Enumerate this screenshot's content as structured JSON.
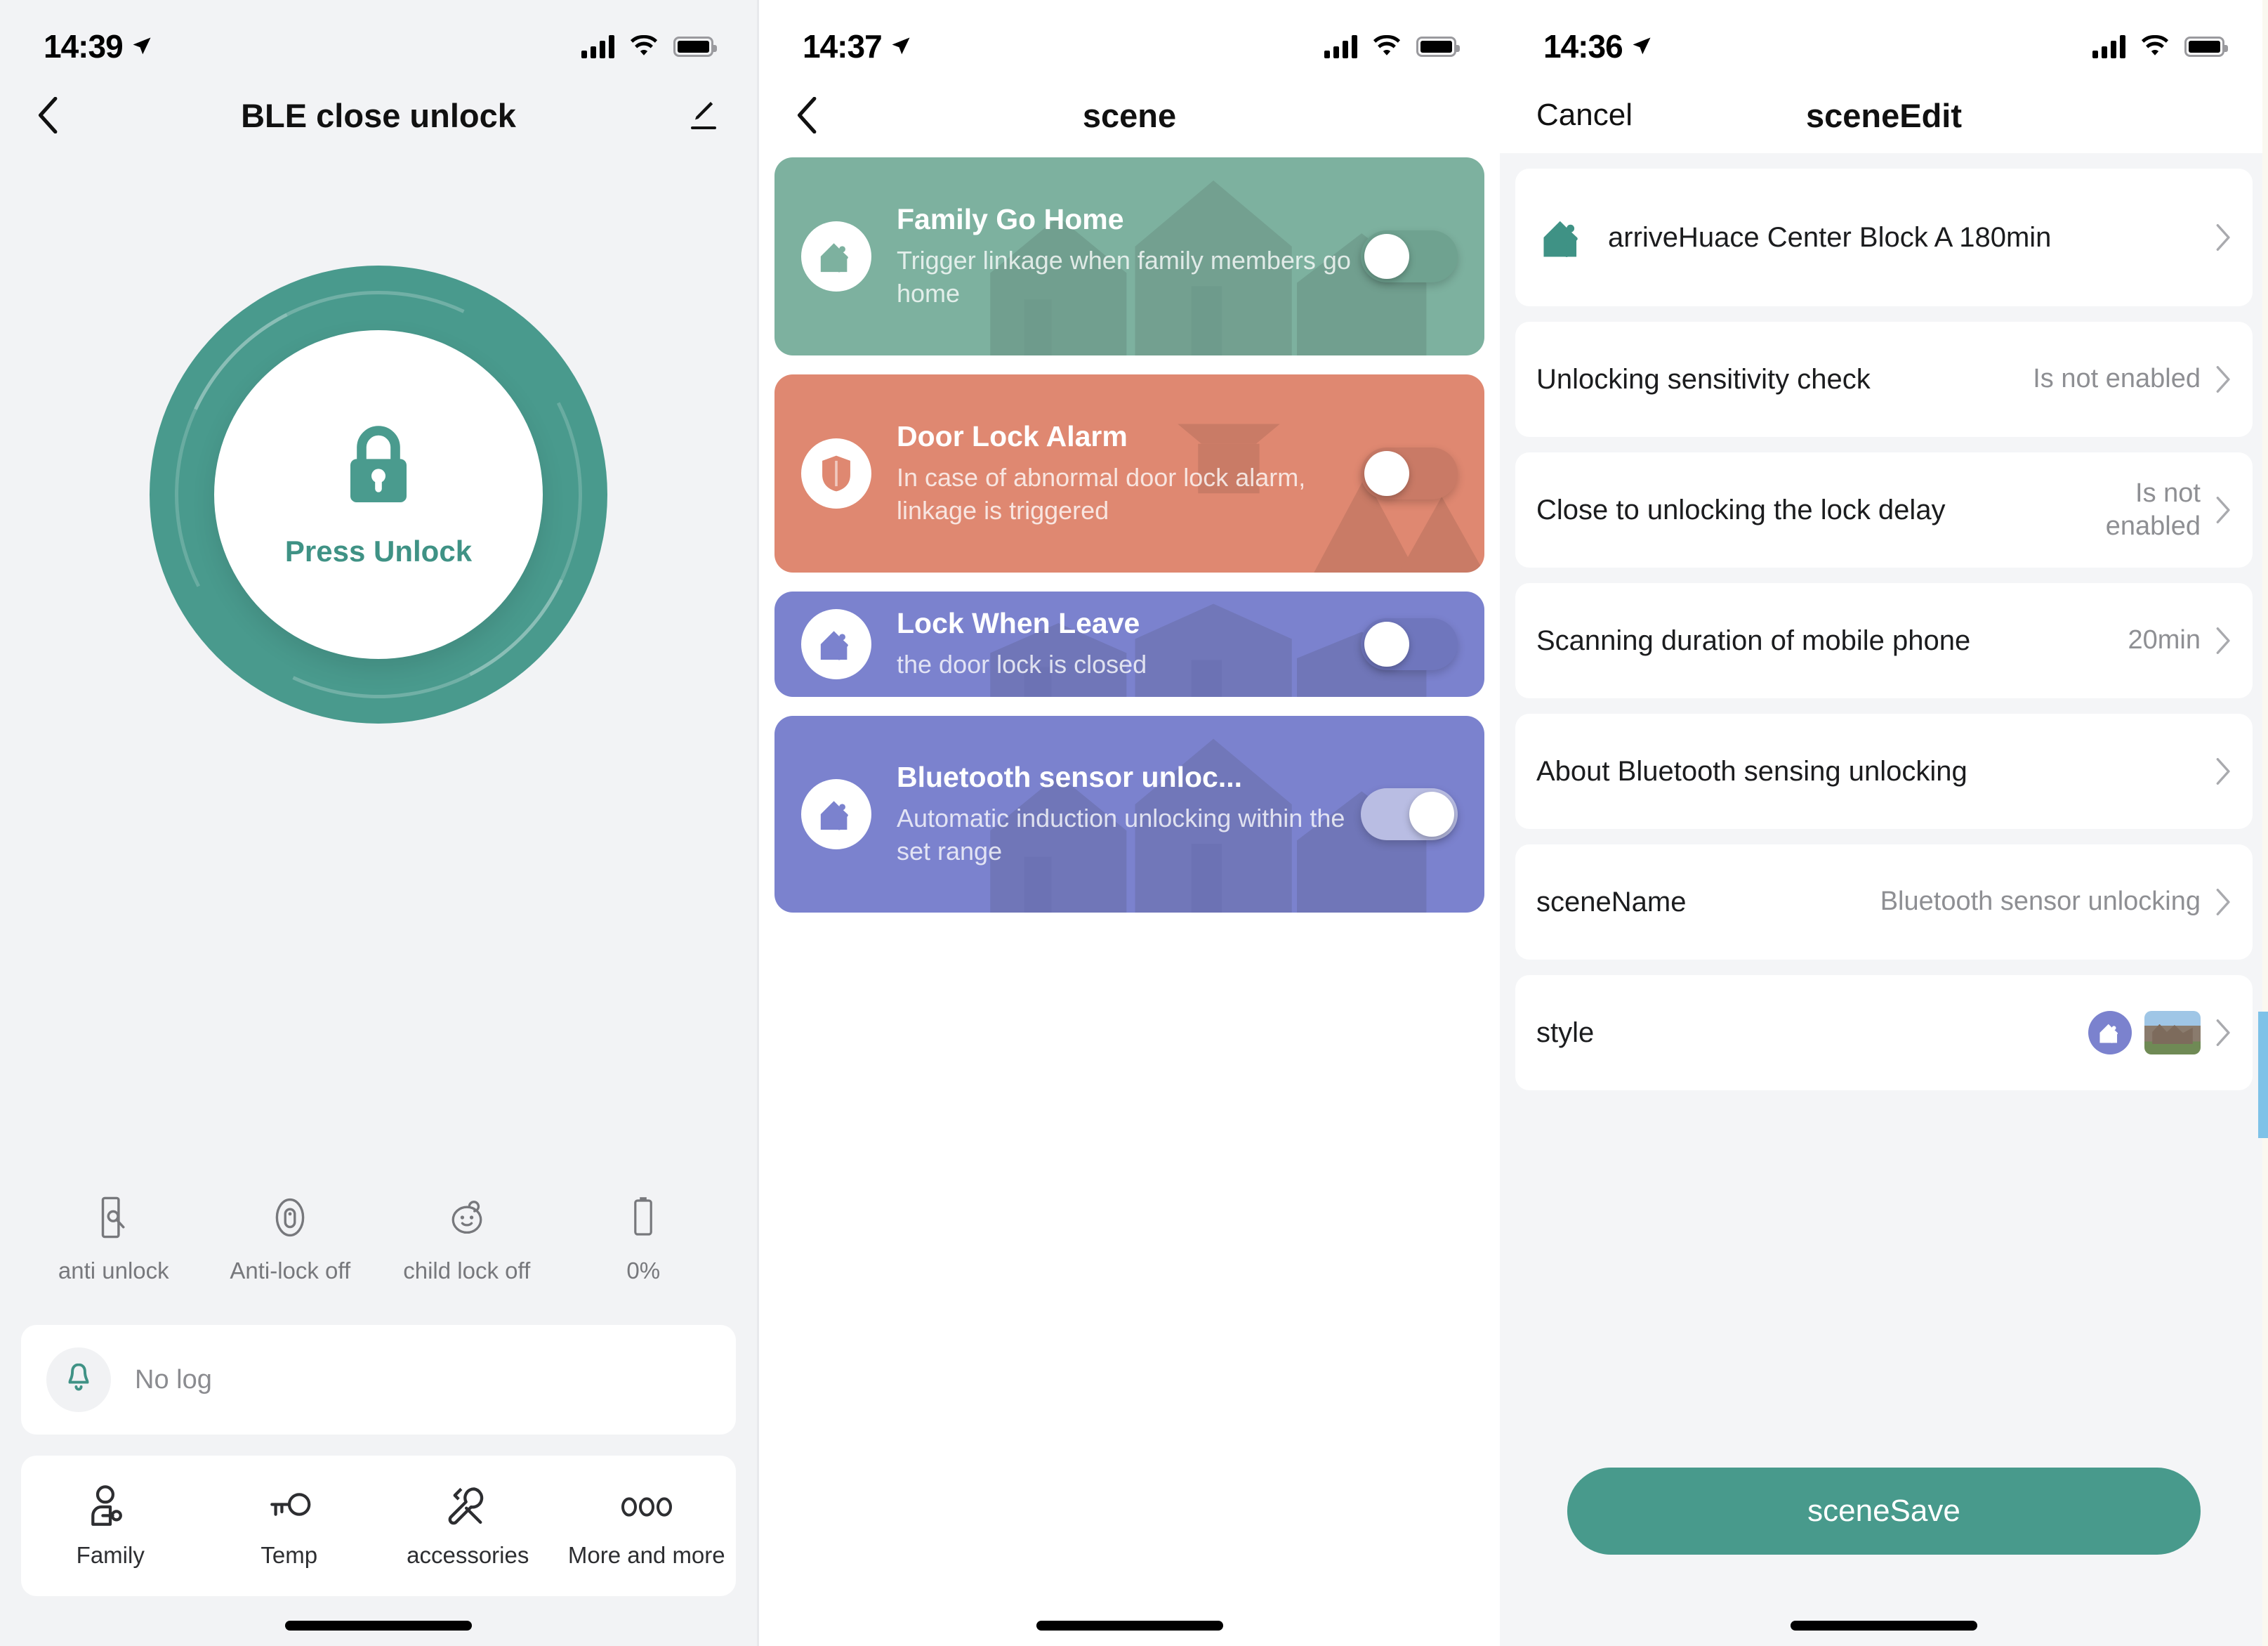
{
  "panel1": {
    "status": {
      "time": "14:39",
      "location_icon": "location-arrow-icon",
      "signal": "cellular-signal-icon",
      "wifi": "wifi-icon",
      "battery": "battery-icon"
    },
    "nav": {
      "back_icon": "chevron-left-icon",
      "title": "BLE close unlock",
      "edit_icon": "pencil-edit-icon"
    },
    "lock": {
      "icon": "padlock-icon",
      "label": "Press Unlock",
      "ring_color": "#499a8d",
      "text_color": "#3f9285"
    },
    "statuses": [
      {
        "icon": "door-sensor-icon",
        "label": "anti unlock"
      },
      {
        "icon": "anti-lock-icon",
        "label": "Anti-lock off"
      },
      {
        "icon": "child-face-icon",
        "label": "child lock off"
      },
      {
        "icon": "battery-vertical-icon",
        "label": "0%"
      }
    ],
    "log": {
      "icon": "bell-icon",
      "text": "No log"
    },
    "tabs": [
      {
        "icon": "family-key-icon",
        "label": "Family"
      },
      {
        "icon": "temp-key-icon",
        "label": "Temp"
      },
      {
        "icon": "tools-icon",
        "label": "accessories"
      },
      {
        "icon": "more-dots-icon",
        "label": "More and more"
      }
    ]
  },
  "panel2": {
    "status": {
      "time": "14:37"
    },
    "nav": {
      "back_icon": "chevron-left-icon",
      "title": "scene"
    },
    "cards": [
      {
        "icon": "home-person-icon",
        "title": "Family Go Home",
        "subtitle": "Trigger linkage when family members go home",
        "enabled": false,
        "color": "#7db19f",
        "track_color": "#6fa290"
      },
      {
        "icon": "shield-icon",
        "title": "Door Lock Alarm",
        "subtitle": "In case of abnormal door lock alarm, linkage is triggered",
        "enabled": false,
        "color": "#df8871",
        "track_color": "#c97a66"
      },
      {
        "icon": "home-person-icon",
        "title": "Lock When Leave",
        "subtitle": "the door lock is closed",
        "enabled": false,
        "color": "#7b82ce",
        "track_color": "#6f76bd"
      },
      {
        "icon": "home-person-icon",
        "title": "Bluetooth sensor unloc...",
        "subtitle": "Automatic induction unlocking within the set range",
        "enabled": true,
        "color": "#7b82ce",
        "track_color": "#b9bde3"
      }
    ]
  },
  "panel3": {
    "status": {
      "time": "14:36"
    },
    "nav": {
      "cancel_label": "Cancel",
      "title": "sceneEdit"
    },
    "rows": [
      {
        "icon": "home-person-green-icon",
        "label": "arriveHuace Center Block A 180min",
        "value": ""
      },
      {
        "icon": "",
        "label": "Unlocking sensitivity check",
        "value": "Is not enabled"
      },
      {
        "icon": "",
        "label": "Close to unlocking the lock delay",
        "value": "Is not enabled"
      },
      {
        "icon": "",
        "label": "Scanning duration of mobile phone",
        "value": "20min"
      },
      {
        "icon": "",
        "label": "About Bluetooth sensing unlocking",
        "value": ""
      },
      {
        "icon": "",
        "label": "sceneName",
        "value": "Bluetooth sensor unlocking"
      },
      {
        "icon": "",
        "label": "style",
        "value": ""
      }
    ],
    "style_row": {
      "circle_icon": "home-person-icon",
      "thumbnail": "house-photo-thumbnail",
      "circle_color": "#7b82ce"
    },
    "save_button": {
      "label": "sceneSave",
      "color": "#489a8c"
    }
  }
}
